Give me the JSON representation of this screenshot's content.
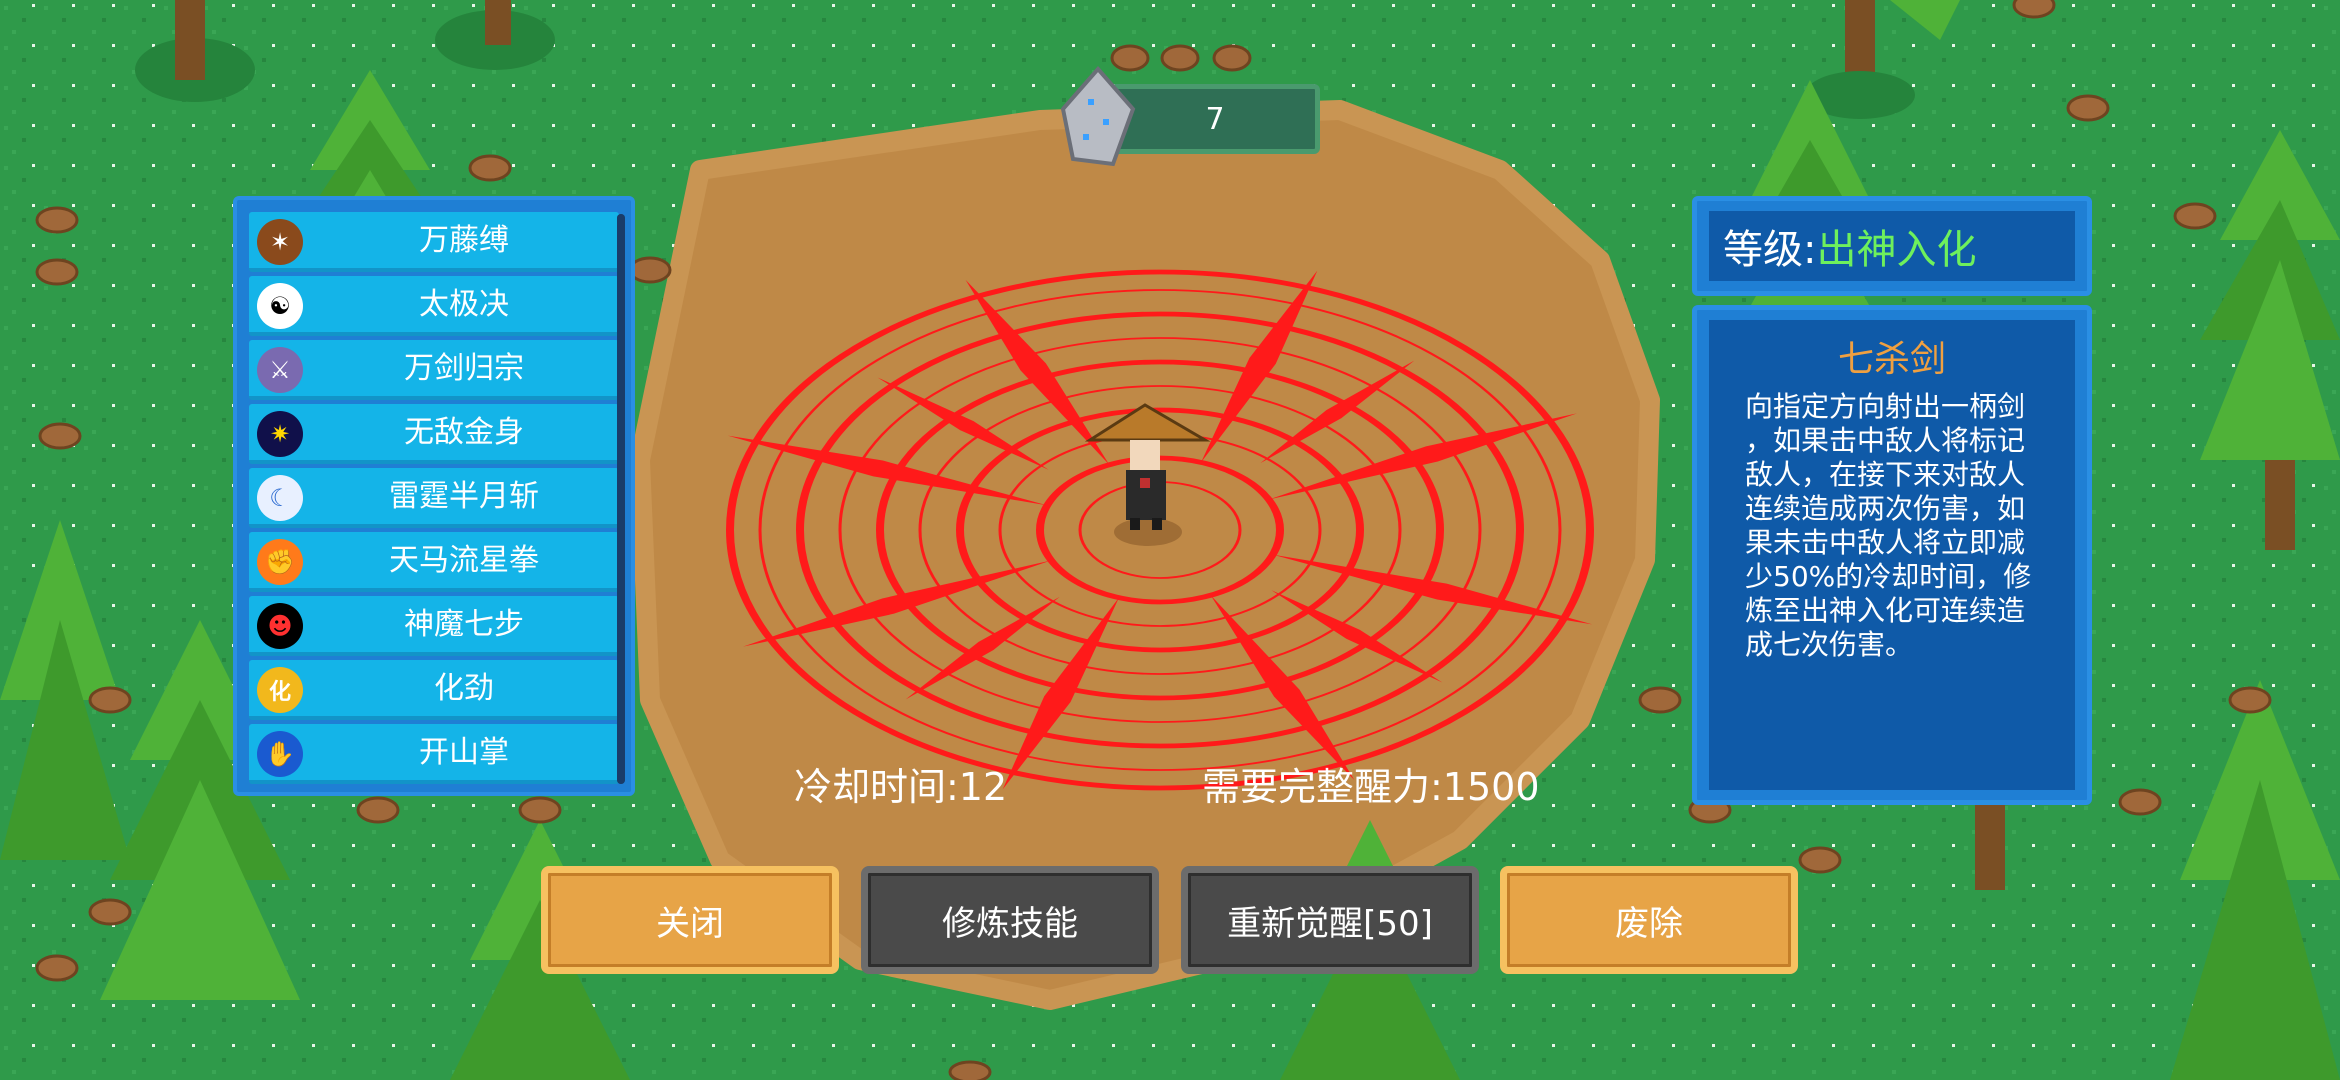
{
  "gem_count": "7",
  "skills": [
    {
      "label": "万藤缚",
      "icon": "vine-icon"
    },
    {
      "label": "太极决",
      "icon": "taiji-icon"
    },
    {
      "label": "万剑归宗",
      "icon": "swords-icon"
    },
    {
      "label": "无敌金身",
      "icon": "golden-body-icon"
    },
    {
      "label": "雷霆半月斩",
      "icon": "crescent-slash-icon"
    },
    {
      "label": "天马流星拳",
      "icon": "meteor-fist-icon"
    },
    {
      "label": "神魔七步",
      "icon": "demon-face-icon"
    },
    {
      "label": "化劲",
      "icon": "hua-icon",
      "icon_text": "化"
    },
    {
      "label": "开山掌",
      "icon": "mountain-palm-icon"
    }
  ],
  "level": {
    "label": "等级:",
    "value": "出神入化"
  },
  "skill_detail": {
    "name": "七杀剑",
    "description": "向指定方向射出一柄剑\n，如果击中敌人将标记\n敌人，在接下来对敌人\n连续造成两次伤害，如\n果未击中敌人将立即减\n少50%的冷却时间，修\n炼至出神入化可连续造\n成七次伤害。"
  },
  "stats": {
    "cooldown": "冷却时间:12",
    "awaken_required": "需要完整醒力:1500"
  },
  "buttons": {
    "close": "关闭",
    "train": "修炼技能",
    "reawaken": "重新觉醒[50]",
    "abolish": "废除"
  },
  "colors": {
    "grass": "#2f9a4a",
    "dirt": "#c08a48",
    "magic_circle": "#ff1a1a",
    "panel": "#1f7fd4",
    "skill_item": "#14b4e8",
    "level_value": "#6ef05c",
    "title_orange": "#f0a040"
  }
}
